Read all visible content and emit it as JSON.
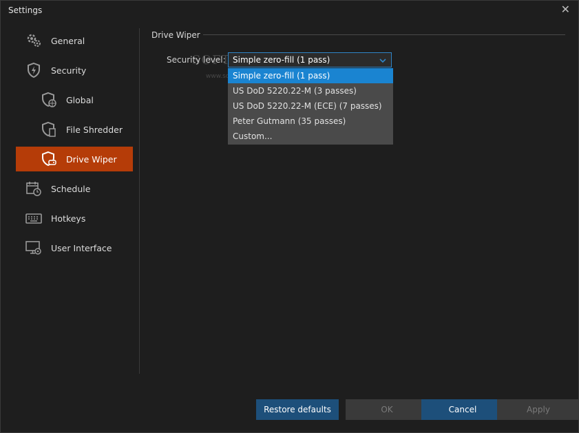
{
  "window": {
    "title": "Settings",
    "close_glyph": "✕"
  },
  "sidebar": {
    "items": [
      {
        "label": "General",
        "icon": "gears-icon"
      },
      {
        "label": "Security",
        "icon": "shield-icon"
      },
      {
        "label": "Global",
        "icon": "shield-globe-icon"
      },
      {
        "label": "File Shredder",
        "icon": "shield-file-icon"
      },
      {
        "label": "Drive Wiper",
        "icon": "shield-drive-icon",
        "active": true
      },
      {
        "label": "Schedule",
        "icon": "calendar-clock-icon"
      },
      {
        "label": "Hotkeys",
        "icon": "keyboard-icon"
      },
      {
        "label": "User Interface",
        "icon": "monitor-icon"
      }
    ]
  },
  "main": {
    "group_title": "Drive Wiper",
    "security_level": {
      "label": "Security level:",
      "value": "Simple zero-fill (1 pass)",
      "options": [
        "Simple zero-fill (1 pass)",
        "US DoD 5220.22-M (3 passes)",
        "US DoD 5220.22-M (ECE) (7 passes)",
        "Peter Gutmann (35 passes)",
        "Custom..."
      ]
    }
  },
  "watermark": {
    "text": "SOFTPEDIA",
    "url": "www.softpedia.com"
  },
  "buttons": {
    "restore": "Restore defaults",
    "ok": "OK",
    "cancel": "Cancel",
    "apply": "Apply"
  },
  "colors": {
    "accent": "#b53c08",
    "selection": "#1a84d1",
    "button_blue": "#1d4f7a"
  }
}
